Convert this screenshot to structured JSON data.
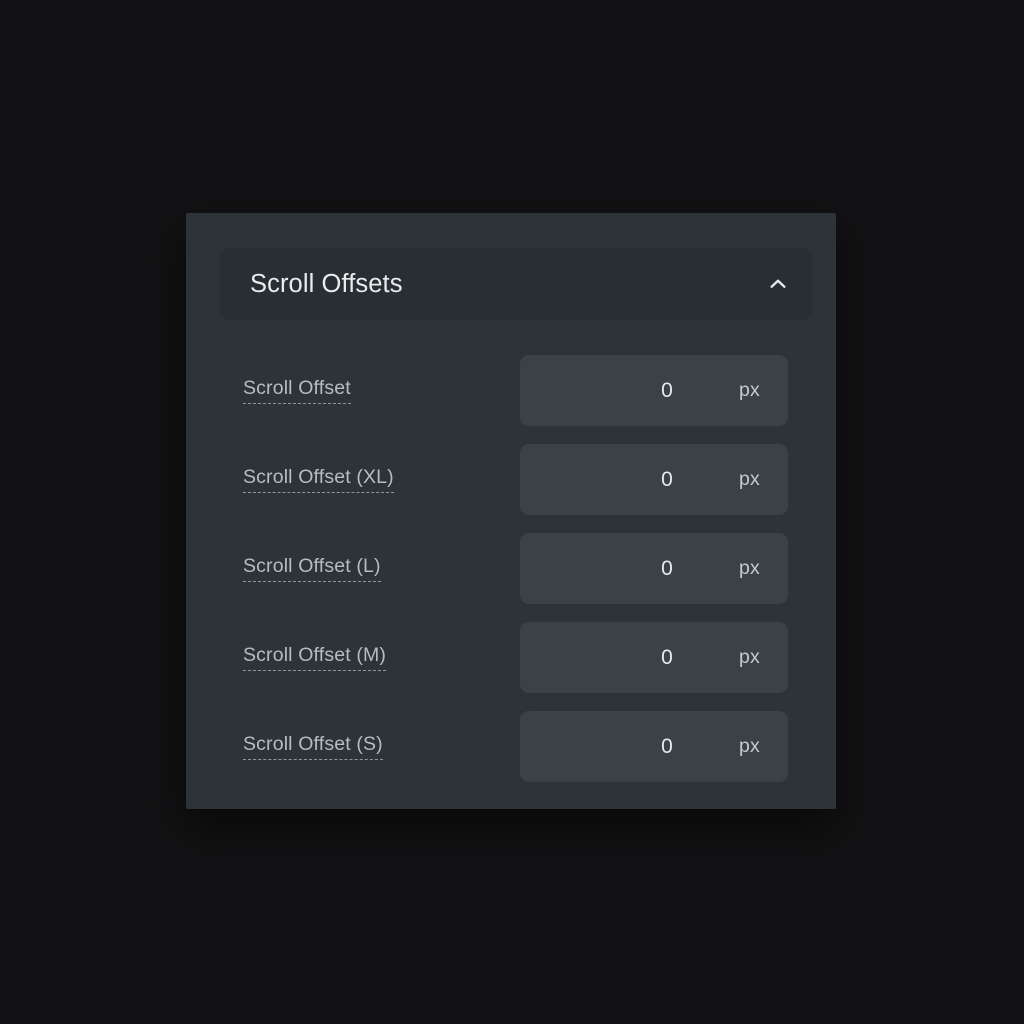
{
  "theme": {
    "page_background": "#121214",
    "panel_background": "#2d3337",
    "header_background": "#282e32",
    "field_background": "#3b4246",
    "title_color": "#e9ecee",
    "label_color": "#b6bdc1",
    "value_color": "#e7eaec",
    "unit_color": "#c3cacd"
  },
  "panel": {
    "section": {
      "title": "Scroll Offsets",
      "collapse_icon": "chevron-up-icon",
      "expanded": true
    },
    "rows": [
      {
        "label": "Scroll Offset",
        "value": "0",
        "unit": "px"
      },
      {
        "label": "Scroll Offset (XL)",
        "value": "0",
        "unit": "px"
      },
      {
        "label": "Scroll Offset (L)",
        "value": "0",
        "unit": "px"
      },
      {
        "label": "Scroll Offset (M)",
        "value": "0",
        "unit": "px"
      },
      {
        "label": "Scroll Offset (S)",
        "value": "0",
        "unit": "px"
      }
    ]
  }
}
